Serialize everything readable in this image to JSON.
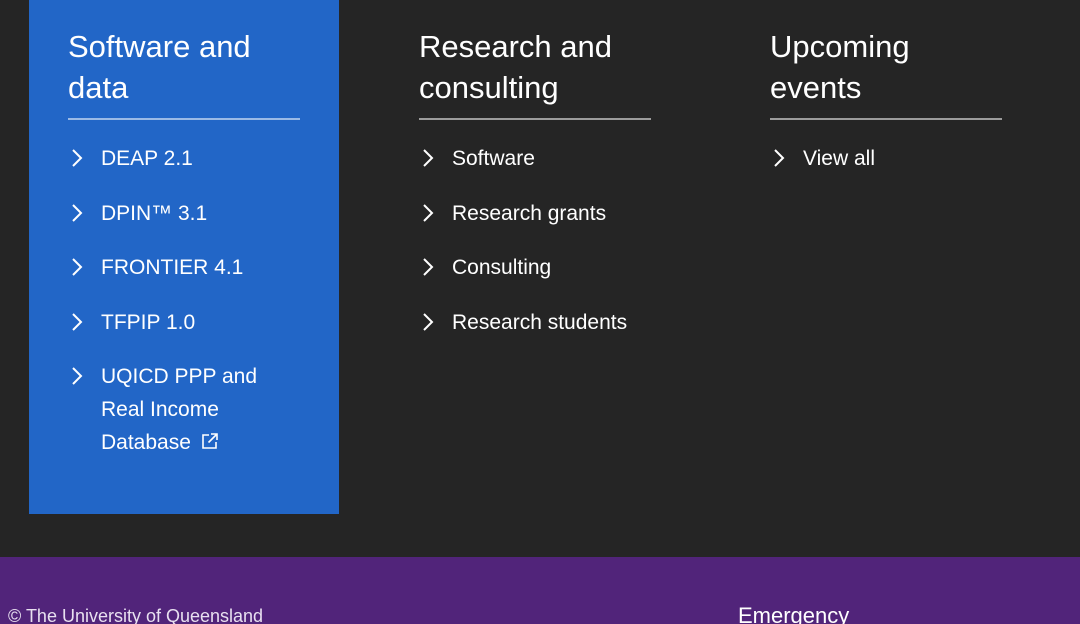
{
  "colors": {
    "dark_background": "#252525",
    "software_panel": "#2266c7",
    "footer_purple": "#51247a",
    "text": "#ffffff"
  },
  "columns": {
    "software": {
      "heading": "Software and data",
      "links": [
        {
          "label": "DEAP 2.1"
        },
        {
          "label": "DPIN™ 3.1"
        },
        {
          "label": "FRONTIER 4.1"
        },
        {
          "label": "TFPIP 1.0"
        },
        {
          "label": "UQICD PPP and Real Income Database",
          "external_icon": "external-link-icon"
        }
      ]
    },
    "research": {
      "heading": "Research and consulting",
      "links": [
        {
          "label": "Software"
        },
        {
          "label": "Research grants"
        },
        {
          "label": "Consulting"
        },
        {
          "label": "Research students"
        }
      ]
    },
    "events": {
      "heading": "Upcoming events",
      "links": [
        {
          "label": "View all"
        }
      ]
    }
  },
  "icons": {
    "link_bullet": "chevron-right-icon"
  },
  "footer": {
    "copyright": "© The University of Queensland",
    "emergency_heading": "Emergency"
  }
}
